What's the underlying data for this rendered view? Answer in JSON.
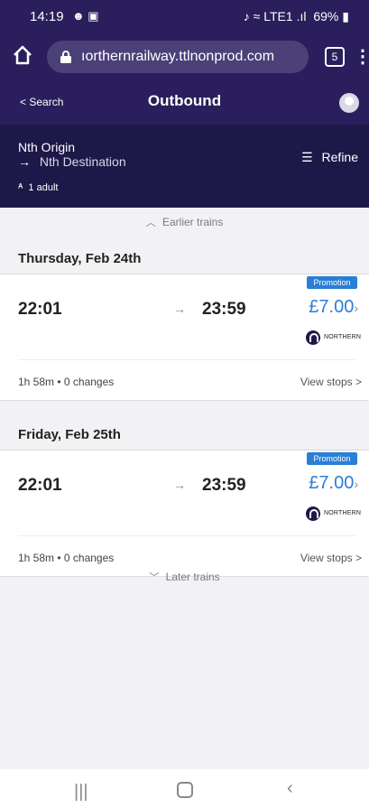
{
  "status_bar": {
    "time": "14:19",
    "notif_icons": "☻ ▣",
    "right_icons": "♪ ≈ LTE1 .ıl",
    "battery": "69%"
  },
  "browser": {
    "url": "ıorthernrailway.ttlnonprod.com",
    "tab_count": "5"
  },
  "header": {
    "back_label": "< Search",
    "title": "Outbound"
  },
  "journey": {
    "origin": "Nth Origin",
    "destination": "Nth Destination",
    "refine_label": "Refine",
    "passengers": "1 adult"
  },
  "earlier_label": "Earlier trains",
  "later_label": "Later trains",
  "days": [
    {
      "date": "Thursday, Feb 24th",
      "promotion": "Promotion",
      "departure": "22:01",
      "arrival": "23:59",
      "price": "£7.00",
      "operator": "NORTHERN",
      "summary": "1h 58m • 0 changes",
      "view_stops": "View stops >"
    },
    {
      "date": "Friday, Feb 25th",
      "promotion": "Promotion",
      "departure": "22:01",
      "arrival": "23:59",
      "price": "£7.00",
      "operator": "NORTHERN",
      "summary": "1h 58m • 0 changes",
      "view_stops": "View stops >"
    }
  ],
  "colors": {
    "brand_dark": "#2a1f5c",
    "panel": "#1e1848",
    "accent": "#2a7fd4"
  }
}
